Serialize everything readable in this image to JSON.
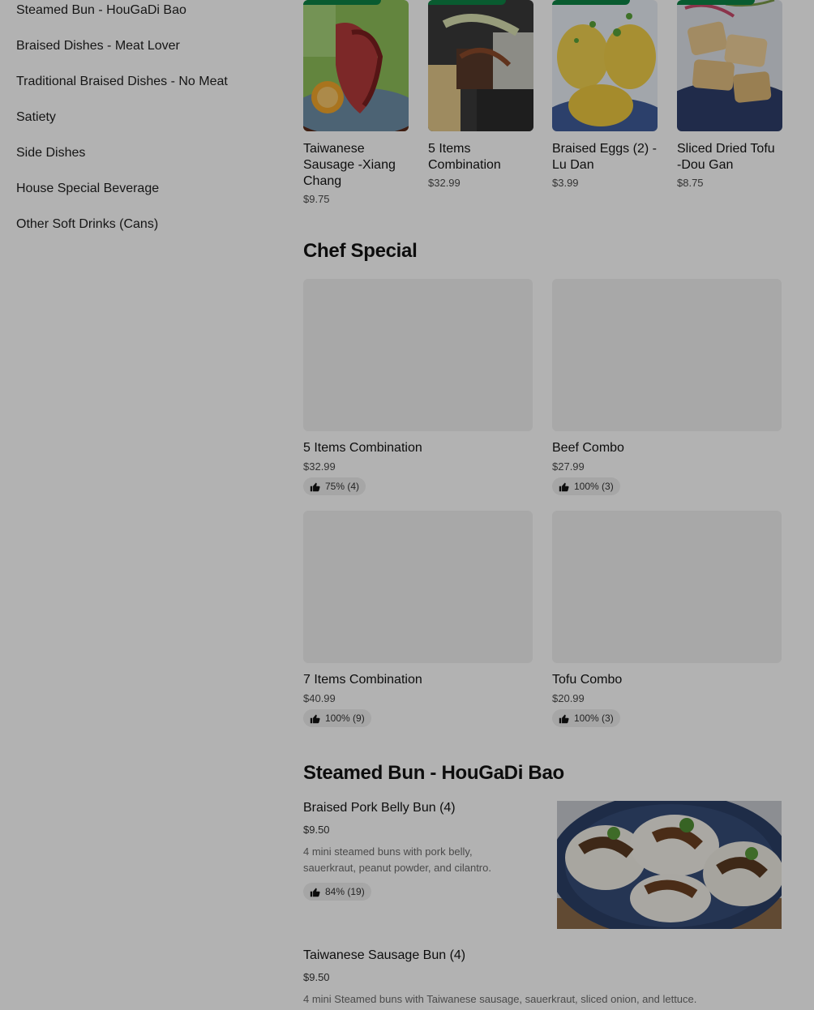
{
  "sidebar": {
    "items": [
      {
        "label": "Steamed Bun - HouGaDi Bao"
      },
      {
        "label": "Braised Dishes - Meat Lover"
      },
      {
        "label": "Traditional Braised Dishes - No Meat"
      },
      {
        "label": "Satiety"
      },
      {
        "label": "Side Dishes"
      },
      {
        "label": "House Special Beverage"
      },
      {
        "label": "Other Soft Drinks (Cans)"
      }
    ]
  },
  "carousel": {
    "items": [
      {
        "title": "Taiwanese Sausage -Xiang Chang",
        "price": "$9.75"
      },
      {
        "title": "5 Items Combination",
        "price": "$32.99"
      },
      {
        "title": "Braised Eggs (2) -Lu Dan",
        "price": "$3.99"
      },
      {
        "title": "Sliced Dried Tofu -Dou Gan",
        "price": "$8.75"
      }
    ]
  },
  "chef_special": {
    "title": "Chef Special",
    "items": [
      {
        "name": "5 Items Combination",
        "price": "$32.99",
        "rating": "75% (4)"
      },
      {
        "name": "Beef Combo",
        "price": "$27.99",
        "rating": "100% (3)"
      },
      {
        "name": "7 Items Combination",
        "price": "$40.99",
        "rating": "100% (9)"
      },
      {
        "name": "Tofu Combo",
        "price": "$20.99",
        "rating": "100% (3)"
      }
    ]
  },
  "steamed_bun": {
    "title": "Steamed Bun - HouGaDi Bao",
    "items": [
      {
        "name": "Braised Pork Belly Bun (4)",
        "price": "$9.50",
        "description": "4 mini steamed buns with pork belly, sauerkraut, peanut powder, and cilantro.",
        "rating": "84% (19)"
      },
      {
        "name": "Taiwanese Sausage Bun (4)",
        "price": "$9.50",
        "description": "4 mini Steamed buns with Taiwanese sausage, sauerkraut, sliced onion, and lettuce."
      }
    ]
  },
  "colors": {
    "accent": "#0e8345",
    "overlay": "rgba(0,0,0,0.30)"
  },
  "icons": {
    "rating": "thumbs-up-icon"
  }
}
